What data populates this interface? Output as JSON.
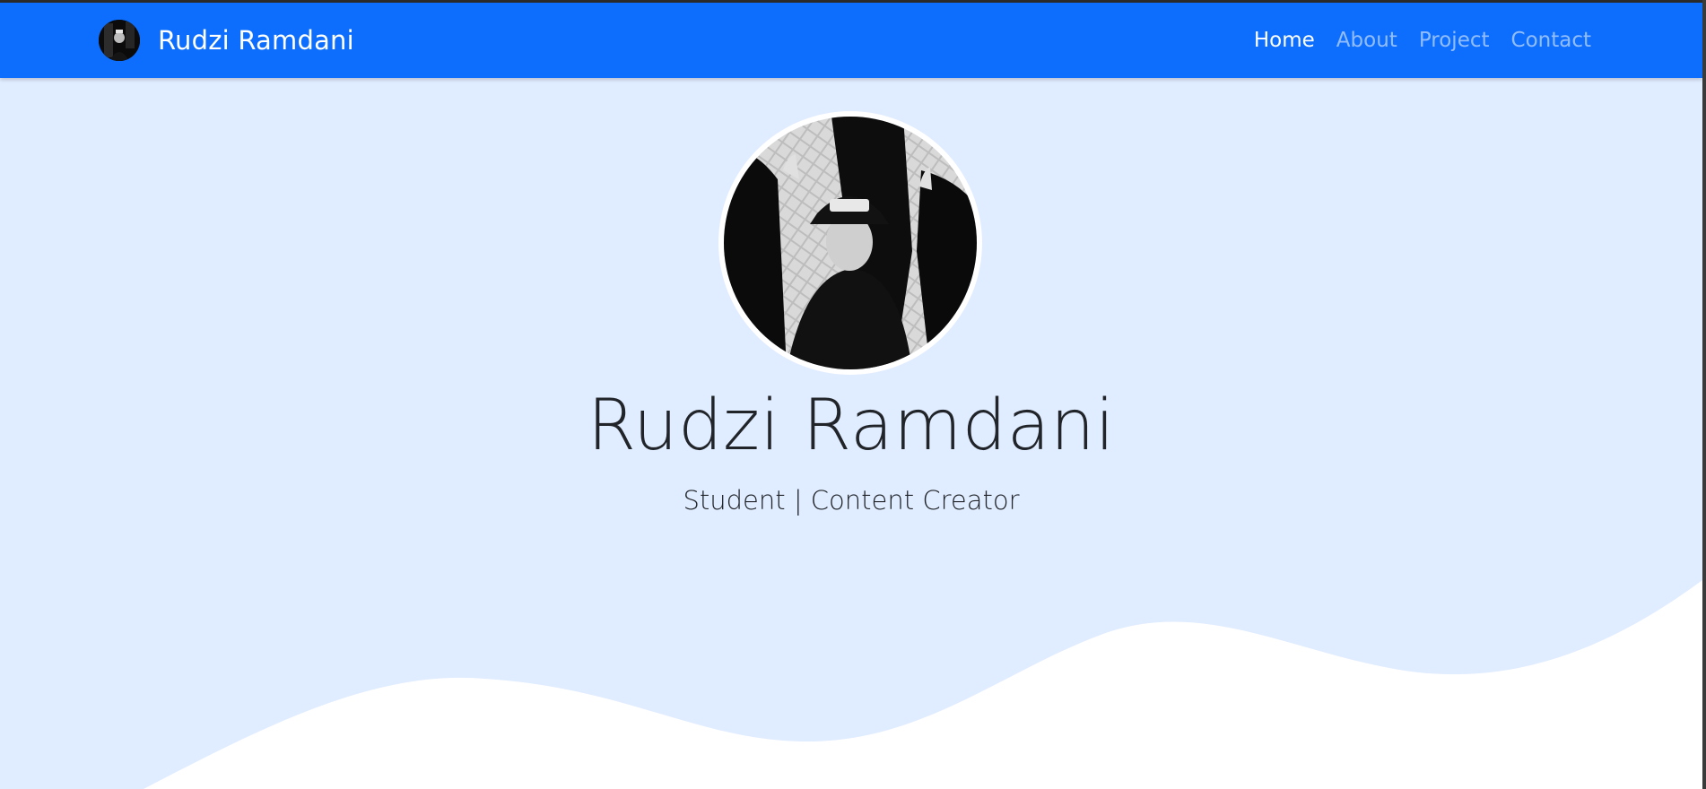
{
  "navbar": {
    "brand_name": "Rudzi Ramdani",
    "brand_avatar_icon": "profile-avatar-icon",
    "links": [
      {
        "label": "Home",
        "active": true
      },
      {
        "label": "About",
        "active": false
      },
      {
        "label": "Project",
        "active": false
      },
      {
        "label": "Contact",
        "active": false
      }
    ]
  },
  "hero": {
    "name": "Rudzi Ramdani",
    "subtitle": "Student | Content Creator",
    "photo_icon": "profile-photo"
  },
  "colors": {
    "navbar": "#0d6efd",
    "hero_background": "#e0ecff",
    "wave": "#ffffff",
    "text": "#212529"
  }
}
